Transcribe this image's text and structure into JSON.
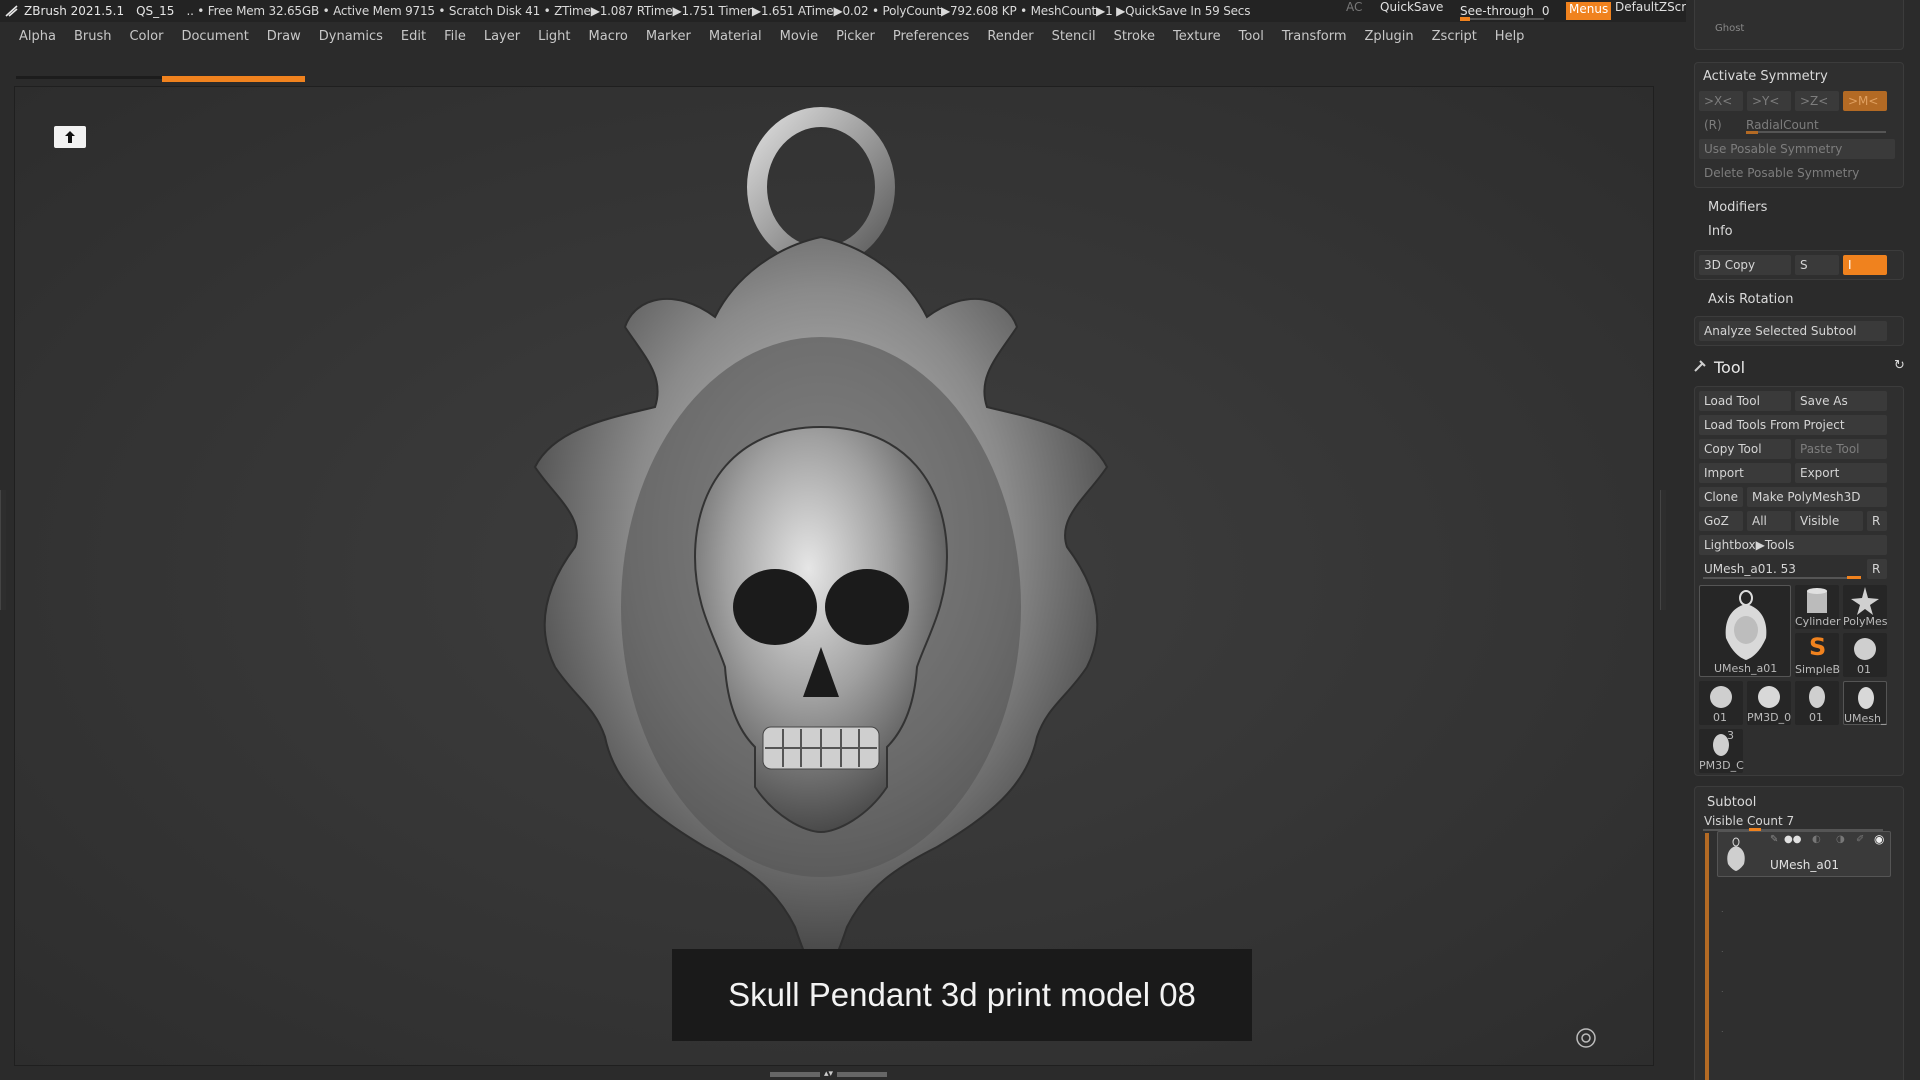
{
  "titlebar": {
    "app_title": "ZBrush 2021.5.1",
    "project": "QS_15",
    "status": ".. • Free Mem 32.65GB • Active Mem 9715 • Scratch Disk 41 •  ZTime▶1.087 RTime▶1.751 Timer▶1.651 ATime▶0.02 • PolyCount▶792.608 KP  • MeshCount▶1  ▶QuickSave In 59 Secs",
    "ac_label": "AC",
    "quicksave_label": "QuickSave",
    "see_through_label": "See-through",
    "see_through_value": "0",
    "menus_label": "Menus",
    "script_label": "DefaultZScript"
  },
  "menubar": {
    "items": [
      "Alpha",
      "Brush",
      "Color",
      "Document",
      "Draw",
      "Dynamics",
      "Edit",
      "File",
      "Layer",
      "Light",
      "Macro",
      "Marker",
      "Material",
      "Movie",
      "Picker",
      "Preferences",
      "Render",
      "Stencil",
      "Stroke",
      "Texture",
      "Tool",
      "Transform",
      "Zplugin",
      "Zscript",
      "Help"
    ]
  },
  "viewport": {
    "caption": "Skull Pendant 3d print model 08"
  },
  "palette": {
    "ghost_label": "Ghost",
    "symmetry": {
      "title": "Activate Symmetry",
      "x_label": ">X<",
      "y_label": ">Y<",
      "z_label": ">Z<",
      "m_label": ">M<",
      "r_label": "(R)",
      "radial_label": "RadialCount",
      "use_posable": "Use Posable Symmetry",
      "delete_posable": "Delete Posable Symmetry"
    },
    "modifiers_label": "Modifiers",
    "info_label": "Info",
    "copy3d_label": "3D Copy",
    "s_label": "S",
    "i_label": "I",
    "axis_rotation_label": "Axis Rotation",
    "analyze_label": "Analyze Selected Subtool",
    "tool": {
      "title": "Tool",
      "load_tool": "Load Tool",
      "save_as": "Save As",
      "load_from_project": "Load Tools From Project",
      "copy_tool": "Copy Tool",
      "paste_tool": "Paste Tool",
      "import": "Import",
      "export": "Export",
      "clone": "Clone",
      "make_polymesh": "Make PolyMesh3D",
      "goz": "GoZ",
      "all": "All",
      "visible": "Visible",
      "r": "R",
      "lightbox": "Lightbox▶Tools",
      "current_tool": "UMesh_a01. 53",
      "thumbs": [
        {
          "label": "UMesh_a01"
        },
        {
          "label": "Cylinder"
        },
        {
          "label": "PolyMes"
        },
        {
          "label": "SimpleB"
        },
        {
          "label": "01"
        },
        {
          "label": "01"
        },
        {
          "label": "PM3D_0"
        },
        {
          "label": "01"
        },
        {
          "label": "UMesh_"
        },
        {
          "label": "PM3D_C"
        }
      ],
      "badge_3": "3"
    },
    "subtool": {
      "title": "Subtool",
      "visible_count": "Visible Count 7",
      "item_label": "UMesh_a01"
    }
  }
}
